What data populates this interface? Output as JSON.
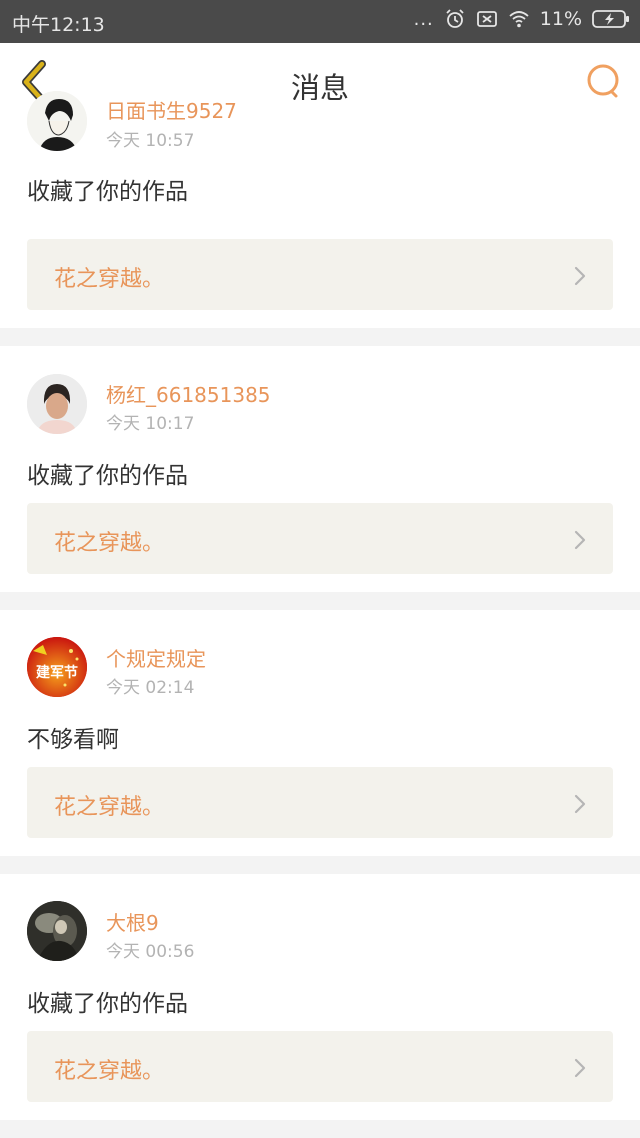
{
  "status_bar": {
    "time": "中午12:13",
    "dots": "...",
    "battery_percent": "11%"
  },
  "header": {
    "title": "消息",
    "back_icon": "chevron-left-icon",
    "search_icon": "search-icon"
  },
  "colors": {
    "accent": "#e8955a",
    "back_icon": "#d9b21a",
    "card_bg": "#ffffff",
    "work_bg": "#f3f2ec",
    "page_bg": "#f3f3f3"
  },
  "messages": [
    {
      "username": "日面书生9527",
      "time": "今天 10:57",
      "action": "收藏了你的作品",
      "work_title": "花之穿越。",
      "avatar": "sketch-avatar"
    },
    {
      "username": "杨红_661851385",
      "time": "今天 10:17",
      "action": "收藏了你的作品",
      "work_title": "花之穿越。",
      "avatar": "photo-avatar"
    },
    {
      "username": "个规定规定",
      "time": "今天 02:14",
      "action": "不够看啊",
      "work_title": "花之穿越。",
      "avatar": "festival-avatar",
      "avatar_text": "建军节"
    },
    {
      "username": "大根9",
      "time": "今天 00:56",
      "action": "收藏了你的作品",
      "work_title": "花之穿越。",
      "avatar": "dark-photo-avatar"
    }
  ]
}
